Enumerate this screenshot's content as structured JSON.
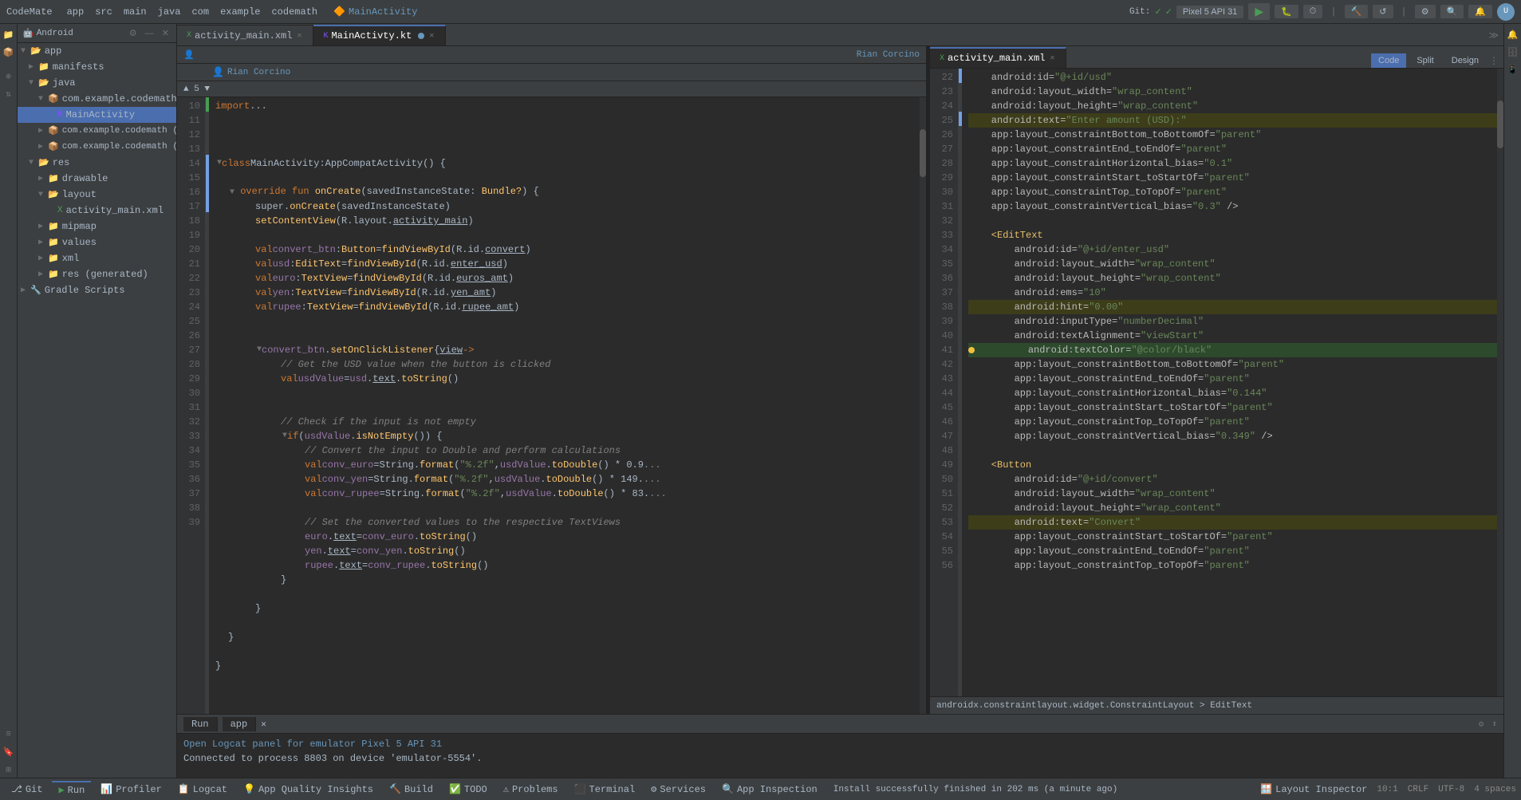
{
  "topbar": {
    "brand": "CodeMate",
    "menus": [
      "app",
      "src",
      "main",
      "java",
      "com",
      "example",
      "codemath"
    ],
    "active_file": "MainActivity",
    "device": "Pixel 5 API 31",
    "git_status": "Git:",
    "run_btn": "▶",
    "icons": [
      "settings-icon",
      "run-configs-icon",
      "build-icon"
    ]
  },
  "project_panel": {
    "title": "Android",
    "items": [
      {
        "label": "app",
        "level": 0,
        "expanded": true,
        "type": "folder"
      },
      {
        "label": "manifests",
        "level": 1,
        "expanded": false,
        "type": "folder"
      },
      {
        "label": "java",
        "level": 1,
        "expanded": true,
        "type": "folder"
      },
      {
        "label": "com.example.codemath",
        "level": 2,
        "expanded": true,
        "type": "package"
      },
      {
        "label": "MainActivity",
        "level": 3,
        "expanded": false,
        "type": "kotlin",
        "selected": true
      },
      {
        "label": "com.example.codemath (and...",
        "level": 2,
        "expanded": false,
        "type": "package"
      },
      {
        "label": "com.example.codemath (test...",
        "level": 2,
        "expanded": false,
        "type": "package"
      },
      {
        "label": "res",
        "level": 1,
        "expanded": true,
        "type": "folder"
      },
      {
        "label": "drawable",
        "level": 2,
        "expanded": false,
        "type": "folder"
      },
      {
        "label": "layout",
        "level": 2,
        "expanded": true,
        "type": "folder"
      },
      {
        "label": "activity_main.xml",
        "level": 3,
        "expanded": false,
        "type": "xml"
      },
      {
        "label": "mipmap",
        "level": 2,
        "expanded": false,
        "type": "folder"
      },
      {
        "label": "values",
        "level": 2,
        "expanded": false,
        "type": "folder"
      },
      {
        "label": "xml",
        "level": 2,
        "expanded": false,
        "type": "folder"
      },
      {
        "label": "res (generated)",
        "level": 2,
        "expanded": false,
        "type": "folder"
      },
      {
        "label": "Gradle Scripts",
        "level": 0,
        "expanded": false,
        "type": "folder"
      }
    ]
  },
  "tabs": {
    "left": [
      {
        "label": "activity_main.xml",
        "active": false,
        "type": "xml",
        "modified": false
      },
      {
        "label": "MainActivty.kt",
        "active": true,
        "type": "kotlin",
        "modified": true
      }
    ],
    "right": [
      {
        "label": "activity_main.xml",
        "active": true,
        "type": "xml"
      }
    ]
  },
  "kt_editor": {
    "author_bar": "Rian Corcino",
    "author_bar2": "Rian Corcino",
    "nav_label": "▲ 5 ▼",
    "lines": [
      {
        "num": 10,
        "content": ""
      },
      {
        "num": 11,
        "content": ""
      },
      {
        "num": 12,
        "content": ""
      },
      {
        "num": 13,
        "content": ""
      },
      {
        "num": 14,
        "content": ""
      },
      {
        "num": 15,
        "content": ""
      },
      {
        "num": 16,
        "content": ""
      },
      {
        "num": 17,
        "content": ""
      },
      {
        "num": 18,
        "content": ""
      },
      {
        "num": 19,
        "content": ""
      },
      {
        "num": 20,
        "content": ""
      },
      {
        "num": 21,
        "content": ""
      },
      {
        "num": 22,
        "content": ""
      },
      {
        "num": 23,
        "content": ""
      },
      {
        "num": 24,
        "content": ""
      },
      {
        "num": 25,
        "content": ""
      },
      {
        "num": 26,
        "content": ""
      },
      {
        "num": 27,
        "content": ""
      },
      {
        "num": 28,
        "content": ""
      },
      {
        "num": 29,
        "content": ""
      },
      {
        "num": 30,
        "content": ""
      },
      {
        "num": 31,
        "content": ""
      },
      {
        "num": 32,
        "content": ""
      },
      {
        "num": 33,
        "content": ""
      },
      {
        "num": 34,
        "content": ""
      },
      {
        "num": 35,
        "content": ""
      },
      {
        "num": 36,
        "content": ""
      },
      {
        "num": 37,
        "content": ""
      },
      {
        "num": 38,
        "content": ""
      },
      {
        "num": 39,
        "content": ""
      }
    ]
  },
  "xml_editor": {
    "view_modes": [
      "Code",
      "Split",
      "Design"
    ],
    "active_view": "Code",
    "breadcrumb": "androidx.constraintlayout.widget.ConstraintLayout > EditText",
    "line_start": 22,
    "lines": [
      {
        "num": 22,
        "content": "android:id=\"@+id/usd\""
      },
      {
        "num": 23,
        "content": "android:layout_width=\"wrap_content\""
      },
      {
        "num": 24,
        "content": "android:layout_height=\"wrap_content\""
      },
      {
        "num": 25,
        "content": "android:text=\"Enter amount (USD):\"",
        "highlighted": true
      },
      {
        "num": 26,
        "content": "app:layout_constraintBottom_toBottomOf=\"parent\""
      },
      {
        "num": 27,
        "content": "app:layout_constraintEnd_toEndOf=\"parent\""
      },
      {
        "num": 28,
        "content": "app:layout_constraintHorizontal_bias=\"0.1\""
      },
      {
        "num": 29,
        "content": "app:layout_constraintStart_toStartOf=\"parent\""
      },
      {
        "num": 30,
        "content": "app:layout_constraintTop_toTopOf=\"parent\""
      },
      {
        "num": 31,
        "content": "app:layout_constraintVertical_bias=\"0.3\" />"
      },
      {
        "num": 32,
        "content": ""
      },
      {
        "num": 33,
        "content": "<EditText"
      },
      {
        "num": 34,
        "content": "    android:id=\"@+id/enter_usd\""
      },
      {
        "num": 35,
        "content": "    android:layout_width=\"wrap_content\""
      },
      {
        "num": 36,
        "content": "    android:layout_height=\"wrap_content\""
      },
      {
        "num": 37,
        "content": "    android:ems=\"10\""
      },
      {
        "num": 38,
        "content": "    android:hint=\"0.00\"",
        "highlighted": true
      },
      {
        "num": 39,
        "content": "    android:inputType=\"numberDecimal\""
      },
      {
        "num": 40,
        "content": "    android:textAlignment=\"viewStart\""
      },
      {
        "num": 41,
        "content": "    android:textColor=\"@color/black\"",
        "current": true
      },
      {
        "num": 42,
        "content": "    app:layout_constraintBottom_toBottomOf=\"parent\""
      },
      {
        "num": 43,
        "content": "    app:layout_constraintEnd_toEndOf=\"parent\""
      },
      {
        "num": 44,
        "content": "    app:layout_constraintHorizontal_bias=\"0.144\""
      },
      {
        "num": 45,
        "content": "    app:layout_constraintStart_toStartOf=\"parent\""
      },
      {
        "num": 46,
        "content": "    app:layout_constraintTop_toTopOf=\"parent\""
      },
      {
        "num": 47,
        "content": "    app:layout_constraintVertical_bias=\"0.349\" />"
      },
      {
        "num": 48,
        "content": ""
      },
      {
        "num": 49,
        "content": "<Button"
      },
      {
        "num": 50,
        "content": "    android:id=\"@+id/convert\""
      },
      {
        "num": 51,
        "content": "    android:layout_width=\"wrap_content\""
      },
      {
        "num": 52,
        "content": "    android:layout_height=\"wrap_content\""
      },
      {
        "num": 53,
        "content": "    android:text=\"Convert\"",
        "highlighted": true
      },
      {
        "num": 54,
        "content": "    app:layout_constraintStart_toStartOf=\"parent\""
      },
      {
        "num": 55,
        "content": "    app:layout_constraintEnd_toEndOf=\"parent\""
      },
      {
        "num": 56,
        "content": "    app:layout_constraintTop_toTopOf=\"parent\""
      }
    ]
  },
  "run_panel": {
    "tabs": [
      "Run",
      "app"
    ],
    "content_line1": "Open Logcat panel for emulator Pixel 5 API 31",
    "content_line2": "Connected to process 8803 on device 'emulator-5554'.",
    "install_msg": "Install successfully finished in 202 ms (a minute ago)"
  },
  "bottom_bar": {
    "tabs": [
      {
        "label": "Git",
        "icon": "git-icon"
      },
      {
        "label": "Run",
        "icon": "run-icon",
        "active": true
      },
      {
        "label": "Profiler",
        "icon": "profiler-icon"
      },
      {
        "label": "Logcat",
        "icon": "logcat-icon"
      },
      {
        "label": "App Quality Insights",
        "icon": "quality-icon"
      },
      {
        "label": "Build",
        "icon": "build-icon"
      },
      {
        "label": "TODO",
        "icon": "todo-icon"
      },
      {
        "label": "Problems",
        "icon": "problems-icon"
      },
      {
        "label": "Terminal",
        "icon": "terminal-icon"
      },
      {
        "label": "Services",
        "icon": "services-icon"
      },
      {
        "label": "App Inspection",
        "icon": "inspection-icon"
      },
      {
        "label": "Layout Inspector",
        "icon": "layout-icon"
      }
    ],
    "status": {
      "position": "10:1",
      "encoding": "CRLF",
      "charset": "UTF-8",
      "spaces": "4 spaces"
    }
  }
}
